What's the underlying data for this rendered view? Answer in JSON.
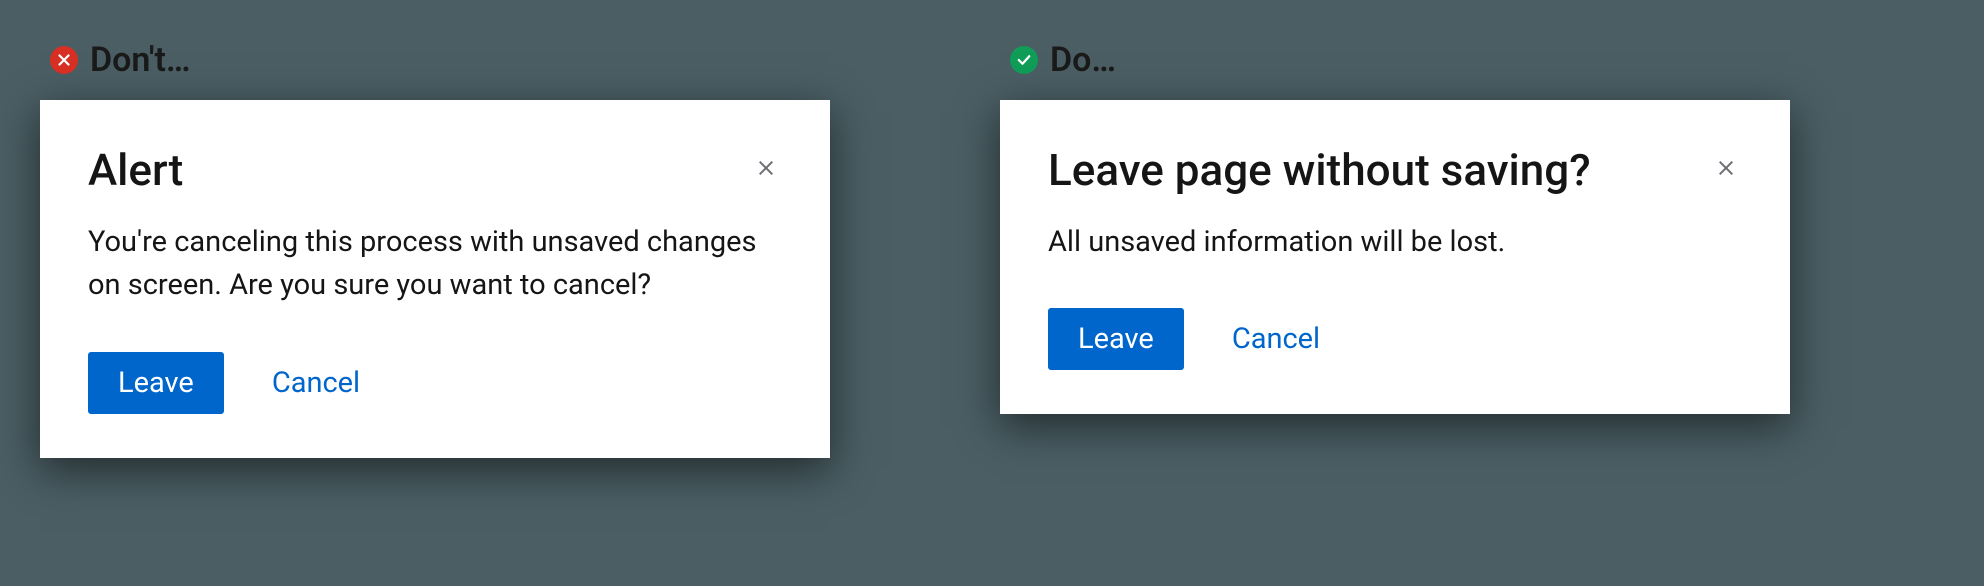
{
  "dont": {
    "label": "Don't…",
    "modal": {
      "title": "Alert",
      "body": "You're canceling this process with unsaved changes on screen. Are you sure you want to cancel?",
      "primary_button": "Leave",
      "secondary_button": "Cancel"
    }
  },
  "do": {
    "label": "Do…",
    "modal": {
      "title": "Leave page without saving?",
      "body": "All unsaved information will be lost.",
      "primary_button": "Leave",
      "secondary_button": "Cancel"
    }
  }
}
